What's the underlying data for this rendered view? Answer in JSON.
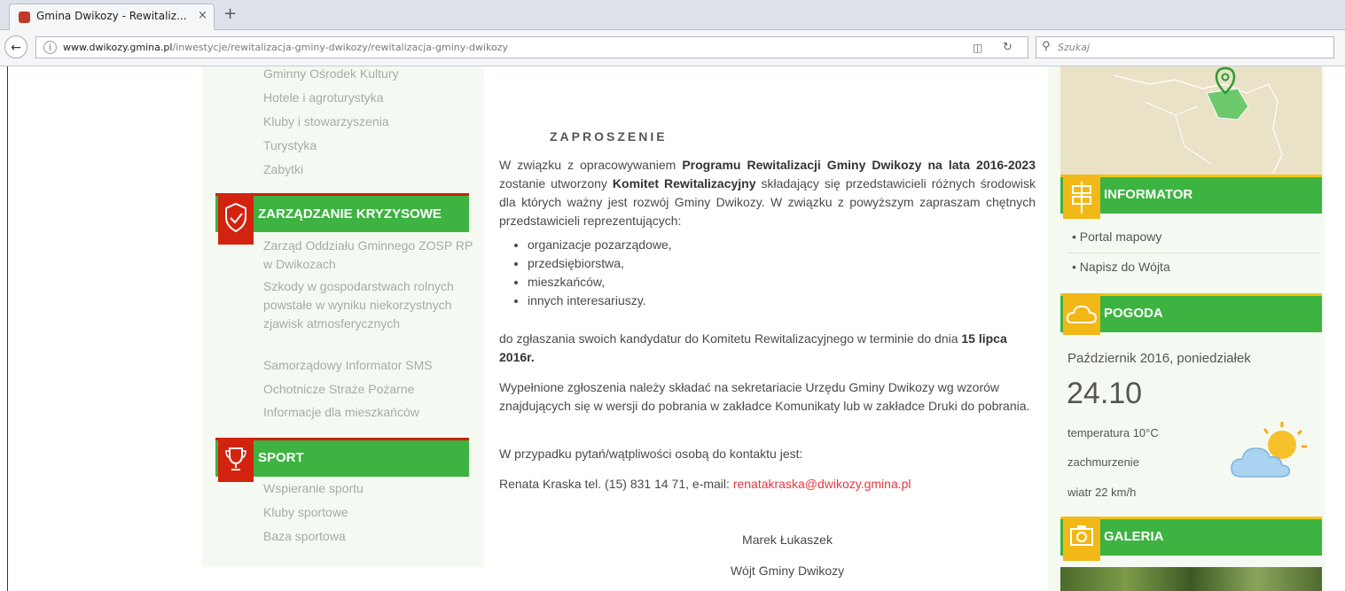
{
  "browser": {
    "tab_title": "Gmina Dwikozy - Rewitaliz...",
    "tab_close": "×",
    "new_tab": "+",
    "url_domain": "www.dwikozy.gmina.pl",
    "url_path": "/inwestycje/rewitalizacja-gminy-dwikozy/rewitalizacja-gminy-dwikozy",
    "search_placeholder": "Szukaj"
  },
  "left_sidebar": {
    "top_links": [
      "Gminny Ośrodek Kultury",
      "Hotele i agroturystyka",
      "Kluby i stowarzyszenia",
      "Turystyka",
      "Zabytki"
    ],
    "crisis": {
      "title": "ZARZĄDZANIE KRYZYSOWE",
      "links": [
        "Zarząd Oddziału Gminnego ZOSP RP w Dwikozach",
        "Szkody w gospodarstwach rolnych powstałe w wyniku niekorzystnych zjawisk atmosferycznych",
        "Samorządowy Informator SMS",
        "Ochotnicze Straże Pożarne",
        "Informacje dla mieszkańców"
      ]
    },
    "sport": {
      "title": "SPORT",
      "links": [
        "Wspieranie sportu",
        "Kluby sportowe",
        "Baza sportowa"
      ]
    }
  },
  "article": {
    "heading": "ZAPROSZENIE",
    "p1_a": "W związku z opracowywaniem ",
    "p1_b": "Programu Rewitalizacji Gminy Dwikozy na lata 2016-2023",
    "p1_c": " zostanie utworzony ",
    "p1_d": "Komitet Rewitalizacyjny",
    "p1_e": " składający się przedstawicieli różnych środowisk dla których ważny jest rozwój Gminy Dwikozy. W związku z powyższym zapraszam chętnych przedstawicieli reprezentujących:",
    "list": [
      "organizacje pozarządowe,",
      "przedsiębiorstwa,",
      "mieszkańców,",
      "innych interesariuszy."
    ],
    "p2_a": "do zgłaszania swoich kandydatur do Komitetu Rewitalizacyjnego w terminie do dnia ",
    "p2_b": "15 lipca 2016r.",
    "p3": "Wypełnione zgłoszenia należy składać na sekretariacie Urzędu Gminy Dwikozy wg wzorów znajdujących się w wersji do pobrania w zakładce Komunikaty lub w zakładce Druki do pobrania.",
    "p4": "W przypadku pytań/wątpliwości osobą do kontaktu jest:",
    "p5_a": "Renata Kraska tel.  (15) 831 14 71, e-mail: ",
    "p5_email": "renatakraska@dwikozy.gmina.pl",
    "signature_name": "Marek Łukaszek",
    "signature_role": "Wójt Gminy Dwikozy"
  },
  "right_sidebar": {
    "informator": {
      "title": "INFORMATOR",
      "links": [
        "Portal mapowy",
        "Napisz do Wójta"
      ]
    },
    "pogoda": {
      "title": "POGODA",
      "date": "Październik 2016, poniedziałek",
      "day": "24.10",
      "temperature": "temperatura 10°C",
      "sky": "zachmurzenie",
      "wind": "wiatr 22 km/h"
    },
    "galeria": {
      "title": "GALERIA"
    }
  },
  "colors": {
    "accent_green": "#3db341",
    "left_icon_red": "#d2230f",
    "right_icon_yellow": "#f1b817",
    "link_red": "#e0393e"
  }
}
